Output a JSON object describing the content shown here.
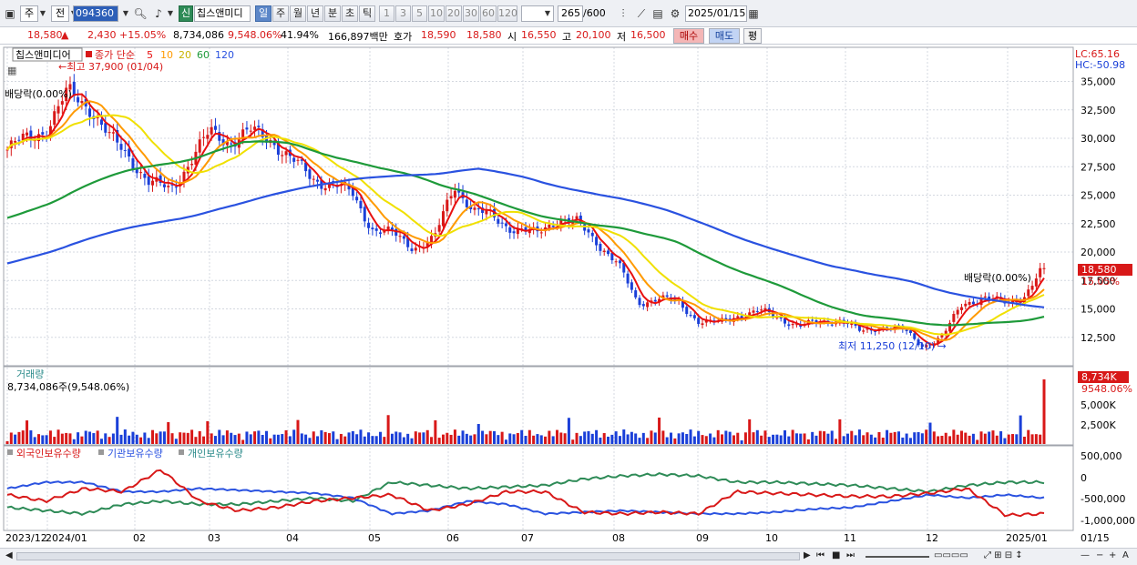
{
  "toolbar": {
    "market": "주",
    "prev": "전",
    "code": "094360",
    "badge": "신",
    "name": "칩스앤미디",
    "periods": [
      "일",
      "주",
      "월",
      "년",
      "분",
      "초",
      "틱"
    ],
    "active_period": "일",
    "intervals": [
      "1",
      "3",
      "5",
      "10",
      "20",
      "30",
      "60",
      "120"
    ],
    "count": "265",
    "count_max": "/600",
    "date": "2025/01/15"
  },
  "quote": {
    "price": "18,580",
    "arrow": "▲",
    "change": "2,430",
    "change_pct": "+15.05%",
    "volume": "8,734,086",
    "volume_pct": "9,548.06%",
    "turnover": "41.94%",
    "amount": "166,897백만",
    "bid_label": "호가",
    "bid1": "18,590",
    "bid2": "18,580",
    "open_label": "시",
    "open": "16,550",
    "high_label": "고",
    "high": "20,100",
    "low_label": "저",
    "low": "16,500",
    "buy": "매수",
    "sell": "매도",
    "eval": "평"
  },
  "price_panel": {
    "title": "칩스앤미디어",
    "legend_label": "종가 단순",
    "ma_labels": [
      "5",
      "10",
      "20",
      "60",
      "120"
    ],
    "ma_colors": [
      "#e81010",
      "#ff9a00",
      "#f0e000",
      "#1e9a3a",
      "#2a52e0"
    ],
    "lc": "LC:65.16",
    "hc": "HC:-50.98",
    "yticks": [
      "35,000",
      "32,500",
      "30,000",
      "27,500",
      "25,000",
      "22,500",
      "20,000",
      "17,500",
      "15,000",
      "12,500"
    ],
    "high_note": "←최고 37,900 (01/04)",
    "low_note": "최저 11,250 (12/10) →",
    "div_note": "배당락(0.00%)",
    "last_price": "18,580",
    "last_pct": "15.05%"
  },
  "volume_panel": {
    "title": "거래량",
    "value": "8,734,086주(9,548.06%)",
    "last": "8,734K",
    "last_pct": "9548.06%",
    "yticks": [
      "5,000K",
      "2,500K"
    ]
  },
  "holdings_panel": {
    "legend": [
      "외국인보유수량",
      "기관보유수량",
      "개인보유수량"
    ],
    "colors": [
      "#d81818",
      "#2a52e0",
      "#2e8b57"
    ],
    "yticks": [
      "500,000",
      "0",
      "-500,000",
      "-1,000,000"
    ]
  },
  "xaxis": {
    "labels": [
      "2023/12",
      "2024/01",
      "02",
      "03",
      "04",
      "05",
      "06",
      "07",
      "08",
      "09",
      "10",
      "11",
      "12",
      "2025/01"
    ],
    "right_label": "01/15"
  },
  "chart_data": {
    "type": "candlestick",
    "ylim": [
      10000,
      38000
    ],
    "ma_periods": [
      5,
      10,
      20,
      60,
      120
    ],
    "close_keypoints": [
      [
        "2023/12",
        29000
      ],
      [
        "2023/12",
        30000
      ],
      [
        "2024/01",
        31000
      ],
      [
        "2024/01",
        34000
      ],
      [
        "2024/01",
        33000
      ],
      [
        "2024/01",
        30000
      ],
      [
        "2024/02",
        28500
      ],
      [
        "2024/02",
        26000
      ],
      [
        "2024/02",
        25500
      ],
      [
        "2024/02",
        28000
      ],
      [
        "2024/03",
        30500
      ],
      [
        "2024/03",
        29800
      ],
      [
        "2024/03",
        30500
      ],
      [
        "2024/03",
        30000
      ],
      [
        "2024/04",
        28000
      ],
      [
        "2024/04",
        26500
      ],
      [
        "2024/04",
        26000
      ],
      [
        "2024/04",
        25000
      ],
      [
        "2024/05",
        22000
      ],
      [
        "2024/05",
        21500
      ],
      [
        "2024/05",
        20500
      ],
      [
        "2024/05",
        21000
      ],
      [
        "2024/06",
        26000
      ],
      [
        "2024/06",
        23500
      ],
      [
        "2024/06",
        23000
      ],
      [
        "2024/06",
        22000
      ],
      [
        "2024/07",
        21500
      ],
      [
        "2024/07",
        23000
      ],
      [
        "2024/07",
        22500
      ],
      [
        "2024/07",
        21000
      ],
      [
        "2024/08",
        19000
      ],
      [
        "2024/08",
        15500
      ],
      [
        "2024/08",
        16000
      ],
      [
        "2024/09",
        15500
      ],
      [
        "2024/09",
        14000
      ],
      [
        "2024/09",
        13700
      ],
      [
        "2024/10",
        14500
      ],
      [
        "2024/10",
        14800
      ],
      [
        "2024/10",
        14200
      ],
      [
        "2024/10",
        13500
      ],
      [
        "2024/11",
        13800
      ],
      [
        "2024/11",
        14100
      ],
      [
        "2024/11",
        12900
      ],
      [
        "2024/11",
        13500
      ],
      [
        "2024/12",
        13200
      ],
      [
        "2024/12",
        11800
      ],
      [
        "2024/12",
        12500
      ],
      [
        "2024/12",
        15500
      ],
      [
        "2024/12",
        16000
      ],
      [
        "2025/01",
        15500
      ],
      [
        "2025/01",
        16100
      ],
      [
        "2025/01",
        18580
      ]
    ]
  }
}
